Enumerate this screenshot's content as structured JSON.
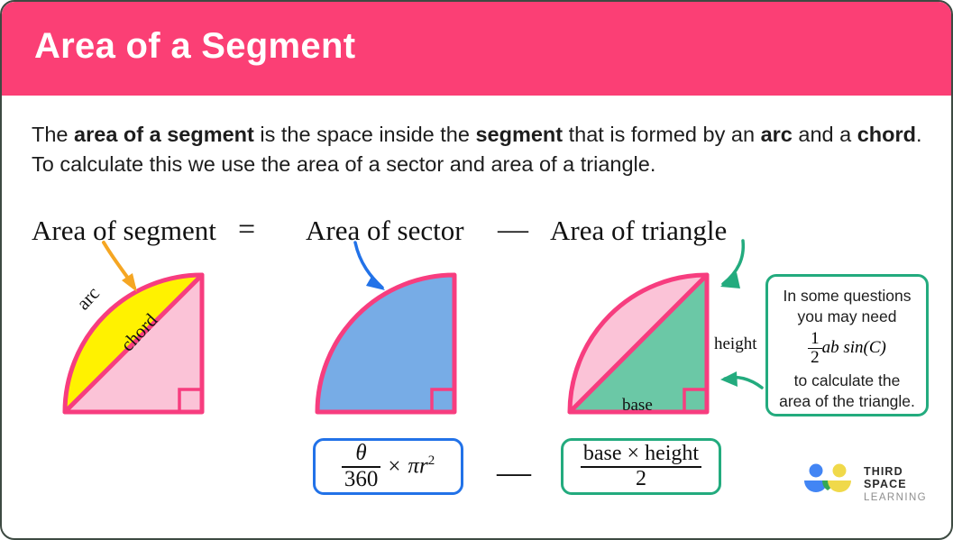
{
  "header": {
    "title": "Area of a Segment",
    "background_color": "#fb3f75",
    "text_color": "#ffffff"
  },
  "intro": {
    "parts": [
      {
        "text": "The ",
        "bold": false
      },
      {
        "text": "area of a segment",
        "bold": true
      },
      {
        "text": " is the space inside the ",
        "bold": false
      },
      {
        "text": "segment",
        "bold": true
      },
      {
        "text": " that is formed by an ",
        "bold": false
      },
      {
        "text": "arc",
        "bold": true
      },
      {
        "text": " and a ",
        "bold": false
      },
      {
        "text": "chord",
        "bold": true
      },
      {
        "text": ".  To calculate this we use the area of a sector and area of a triangle.",
        "bold": false
      }
    ]
  },
  "equation_row": {
    "segment_term": "Area of segment",
    "equals_sign": "=",
    "sector_term": "Area of sector",
    "minus_sign": "—",
    "triangle_term": "Area of triangle"
  },
  "diagrams": {
    "segment": {
      "name": "segment-diagram",
      "arc_label": "arc",
      "chord_label": "chord",
      "segment_fill": "#fff200",
      "triangle_fill": "#fbc3d7",
      "stroke": "#f73d7f",
      "arrow_color": "#f5a623"
    },
    "sector": {
      "name": "sector-diagram",
      "fill": "#77ace6",
      "stroke": "#f73d7f",
      "arrow_color": "#2272e8"
    },
    "triangle": {
      "name": "triangle-diagram",
      "triangle_fill": "#6bc8a6",
      "sector_fill": "#fbc3d7",
      "stroke": "#f73d7f",
      "arrow_color": "#23ab7e",
      "height_label": "height",
      "base_label": "base"
    }
  },
  "callout": {
    "line1": "In some questions",
    "line2": "you may need",
    "formula_numerator": "1",
    "formula_denominator": "2",
    "formula_rest": "ab sin(C)",
    "line3": "to calculate the",
    "line4": "area of the triangle.",
    "border_color": "#23ab7e"
  },
  "formulas": {
    "sector": {
      "numerator": "θ",
      "denominator": "360",
      "times": "×",
      "rest": "πr",
      "exponent": "2",
      "border_color": "#2272e8"
    },
    "minus_between": "—",
    "triangle": {
      "numerator": "base × height",
      "denominator": "2",
      "border_color": "#23ab7e"
    }
  },
  "logo": {
    "line1": "THIRD SPACE",
    "line2": "LEARNING",
    "blue": "#4285f4",
    "yellow": "#f0d94a",
    "green": "#34a853"
  }
}
